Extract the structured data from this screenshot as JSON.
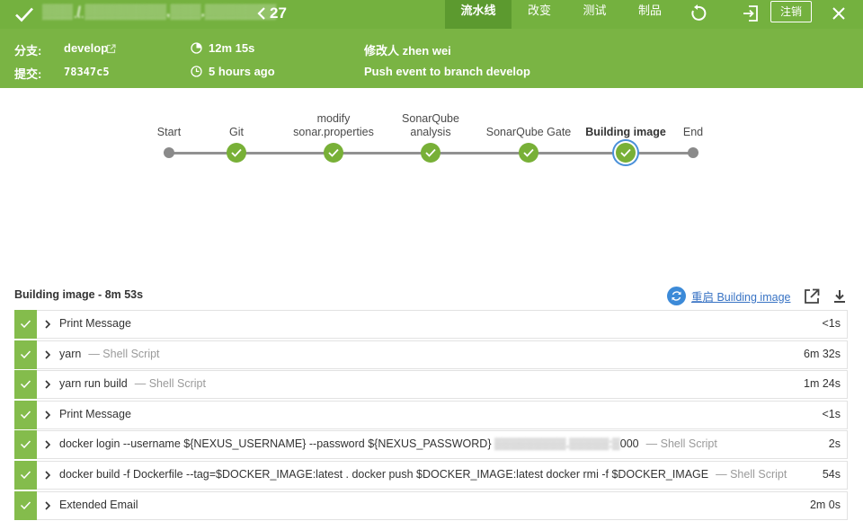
{
  "header": {
    "job_path": "▒▒▒ / ▒▒▒▒▒▒▒▒.▒▒▒.▒▒▒▒▒▒▒",
    "run_number": "27",
    "tabs": [
      "流水线",
      "改变",
      "测试",
      "制品"
    ],
    "logout_label": "注销"
  },
  "run_info": {
    "branch_label": "分支:",
    "branch": "develop",
    "commit_label": "提交:",
    "commit": "78347c5",
    "duration": "12m 15s",
    "started": "5 hours ago",
    "changed_by": "修改人 zhen wei",
    "cause": "Push event to branch develop"
  },
  "pipeline": {
    "stages": [
      {
        "label": "Start",
        "status": "start"
      },
      {
        "label": "Git",
        "status": "success"
      },
      {
        "label": "modify\nsonar.properties",
        "status": "success"
      },
      {
        "label": "SonarQube\nanalysis",
        "status": "success"
      },
      {
        "label": "SonarQube Gate",
        "status": "success"
      },
      {
        "label": "Building image",
        "status": "selected"
      },
      {
        "label": "End",
        "status": "end"
      }
    ]
  },
  "log": {
    "title": "Building image - 8m 53s",
    "restart_label": "重启 Building image",
    "steps": [
      {
        "text": "Print Message",
        "sub": "",
        "duration": "<1s"
      },
      {
        "text": "yarn",
        "sub": "— Shell Script",
        "duration": "6m 32s"
      },
      {
        "text": "yarn run build",
        "sub": "— Shell Script",
        "duration": "1m 24s"
      },
      {
        "text": "Print Message",
        "sub": "",
        "duration": "<1s"
      },
      {
        "text": "docker login --username ${NEXUS_USERNAME} --password ${NEXUS_PASSWORD} ",
        "blur": "▒▒▒▒▒▒▒▒▒.▒▒▒▒▒:▒",
        "tail": "000",
        "sub": "— Shell Script",
        "duration": "2s"
      },
      {
        "text": "docker build -f Dockerfile --tag=$DOCKER_IMAGE:latest . docker push $DOCKER_IMAGE:latest docker rmi -f $DOCKER_IMAGE",
        "sub": "— Shell Script",
        "duration": "54s"
      },
      {
        "text": "Extended Email",
        "sub": "",
        "duration": "2m 0s"
      }
    ]
  },
  "colors": {
    "success": "#78b037",
    "header": "#74b13f",
    "link": "#3873c4"
  }
}
